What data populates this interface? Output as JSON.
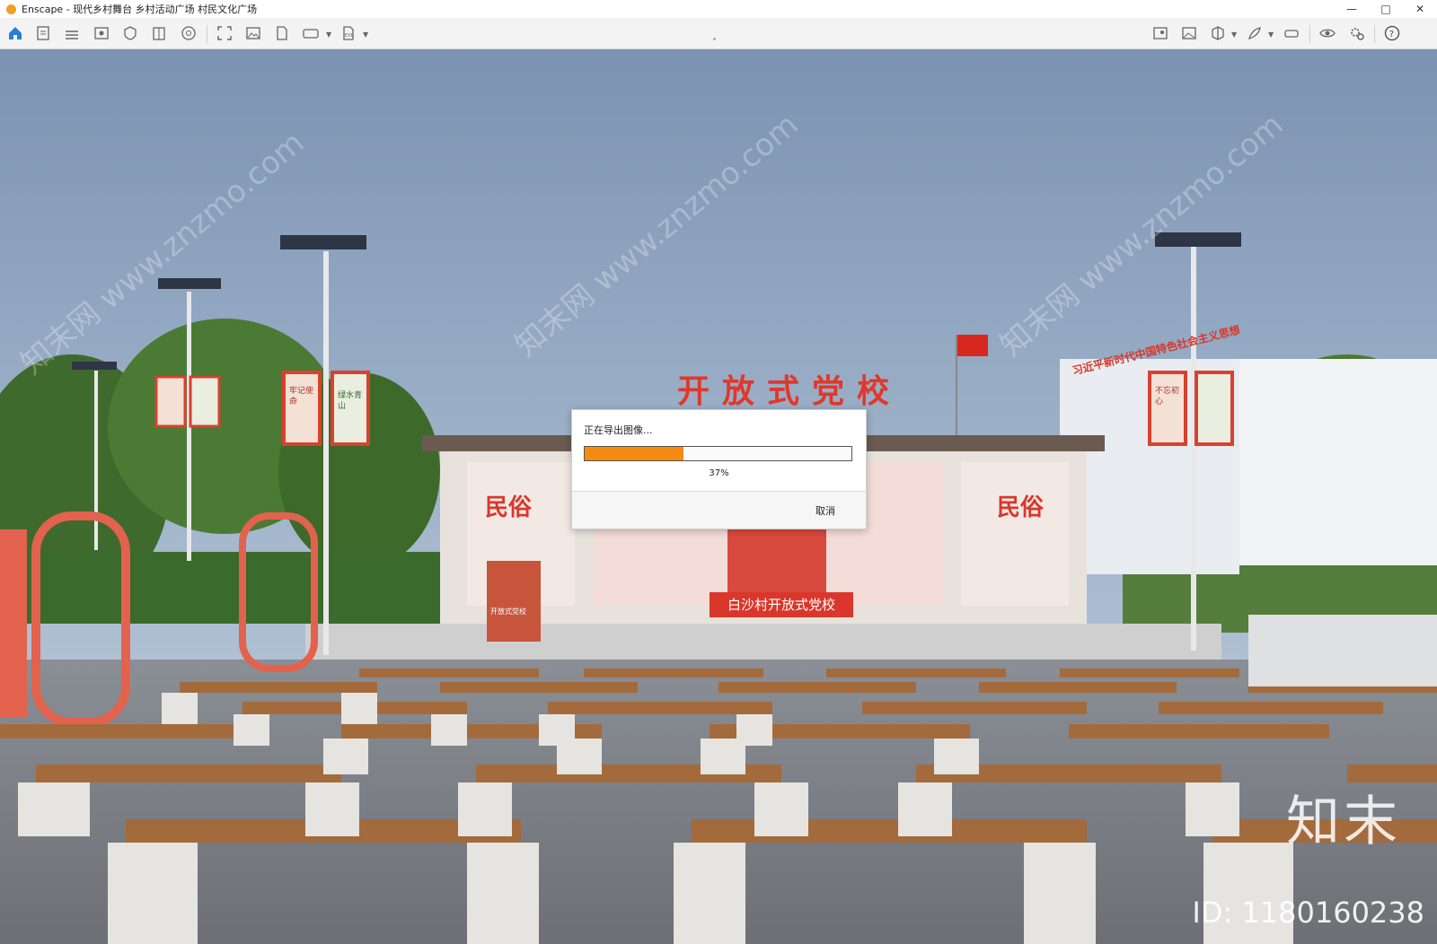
{
  "window": {
    "title": "Enscape - 现代乡村舞台 乡村活动广场 村民文化广场",
    "controls": [
      "minimize-icon",
      "maximize-icon",
      "close-icon"
    ]
  },
  "toolbar": {
    "left_icons": [
      "home-icon",
      "document-icon",
      "bim-icon",
      "eye-panel-icon",
      "shield-icon",
      "book-icon",
      "settings-wheel-icon",
      "capture-icon",
      "image-icon",
      "file-render-icon",
      "panorama-icon",
      "export-exe-icon"
    ],
    "right_icons": [
      "map-icon",
      "image-editor-icon",
      "cube-icon",
      "feather-icon",
      "vr-headset-icon",
      "visibility-icon",
      "settings-icon",
      "help-icon"
    ],
    "collapse_icon": "chevron-up-icon"
  },
  "scene": {
    "watermark_text": "知末网 www.znzmo.com",
    "stage_sign": "开放式党校",
    "podium_label": "开放式党校",
    "banner": "白沙村开放式党校",
    "panel_left": "民俗",
    "panel_right": "民俗",
    "side_slogan_1": "牢记使命",
    "side_slogan_2": "不忘初心",
    "side_slogan_3": "绿水青山",
    "building_sign": "习近平新时代中国特色社会主义思想",
    "brand": "知末",
    "brand_id": "ID: 1180160238"
  },
  "dialog": {
    "title": "正在导出图像...",
    "progress": 0.37,
    "progress_text": "37%",
    "cancel_label": "取消"
  },
  "colors": {
    "progress_fill": "#f58a10",
    "accent_red": "#d93a2c",
    "sky": "#7f98b7"
  }
}
